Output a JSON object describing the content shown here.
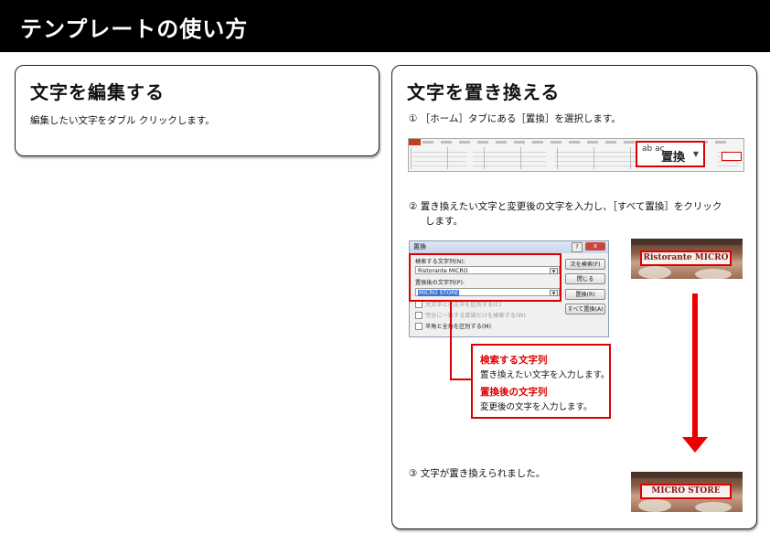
{
  "header": {
    "title": "テンプレートの使い方"
  },
  "left_panel": {
    "title": "文字を編集する",
    "text": "編集したい文字をダブル クリックします。"
  },
  "right_panel": {
    "title": "文字を置き換える",
    "step1": "① ［ホーム］タブにある［置換］を選択します。",
    "step2_line1": "② 置き換えたい文字と変更後の文字を入力し、［すべて置換］をクリック",
    "step2_line2": "します。",
    "step3": "③ 文字が置き換えられました。"
  },
  "ribbon": {
    "replace_label": "置換",
    "replace_icon_text": "ab ac"
  },
  "dialog": {
    "title": "置換",
    "find_label": "検索する文字列(N):",
    "find_value": "Ristorante MICRO",
    "replace_label": "置換後の文字列(P):",
    "replace_value": "MICRO STORE",
    "check1": "大文字と小文字を区別する(C)",
    "check2": "完全に一致する単語だけを検索する(W)",
    "check3": "半角と全角を区別する(M)",
    "btn_find_next": "次を検索(F)",
    "btn_close": "閉じる",
    "btn_replace": "置換(R)",
    "btn_replace_all": "すべて置換(A)",
    "help": "?",
    "close_x": "x"
  },
  "callout": {
    "heading1": "検索する文字列",
    "text1": "置き換えたい文字を入力します。",
    "heading2": "置換後の文字列",
    "text2": "変更後の文字を入力します。"
  },
  "photos": {
    "before": "Ristorante MICRO",
    "after": "MICRO STORE"
  },
  "colors": {
    "accent_red": "#dd0000",
    "header_bg": "#000000"
  }
}
